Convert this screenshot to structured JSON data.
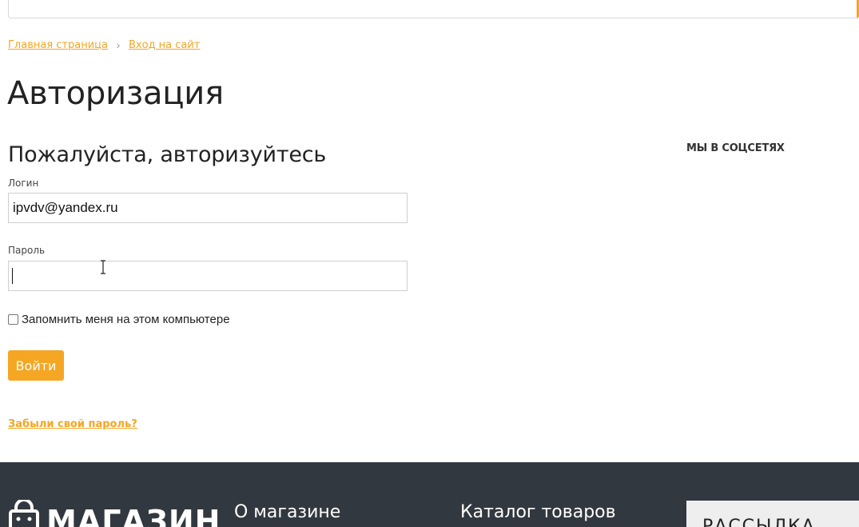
{
  "breadcrumb": {
    "items": [
      {
        "label": "Главная страница"
      },
      {
        "label": "Вход на сайт"
      }
    ],
    "separator": "›"
  },
  "page": {
    "title": "Авторизация"
  },
  "form": {
    "heading": "Пожалуйста, авторизуйтесь",
    "login_label": "Логин",
    "login_value": "ipvdv@yandex.ru",
    "password_label": "Пароль",
    "password_value": "",
    "remember_label": "Запомнить меня на этом компьютере",
    "remember_checked": false,
    "submit_label": "Войти",
    "forgot_label": "Забыли свой пароль?"
  },
  "sidebar": {
    "social_title": "МЫ В СОЦСЕТЯХ"
  },
  "footer": {
    "logo_text": "МАГАЗИН",
    "about_title": "О магазине",
    "catalog_title": "Каталог товаров",
    "newsletter_title": "РАССЫЛКА"
  },
  "colors": {
    "accent": "#f5a623",
    "footer_bg": "#32383f"
  }
}
